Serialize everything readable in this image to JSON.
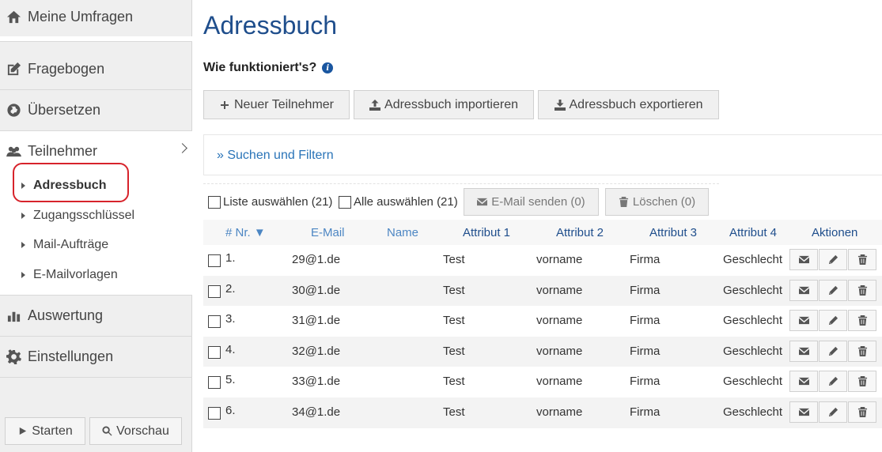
{
  "sidebar": {
    "my_surveys": "Meine Umfragen",
    "questionnaire": "Fragebogen",
    "translate": "Übersetzen",
    "participants": "Teilnehmer",
    "sub_items": [
      "Adressbuch",
      "Zugangsschlüssel",
      "Mail-Aufträge",
      "E-Mailvorlagen"
    ],
    "evaluation": "Auswertung",
    "settings": "Einstellungen",
    "start_button": "Starten",
    "preview_button": "Vorschau"
  },
  "main": {
    "title": "Adressbuch",
    "howto": "Wie funktioniert's?",
    "info_icon": "i",
    "buttons": {
      "new_participant": "Neuer Teilnehmer",
      "import": "Adressbuch importieren",
      "export": "Adressbuch exportieren"
    },
    "filter_link": "» Suchen und Filtern",
    "select_list": "Liste auswählen (21)",
    "select_all": "Alle auswählen (21)",
    "send_email": "E-Mail senden (0)",
    "delete": "Löschen (0)"
  },
  "table": {
    "headers": {
      "nr": "# Nr. ▼",
      "email": "E-Mail",
      "name": "Name",
      "attr1": "Attribut 1",
      "attr2": "Attribut 2",
      "attr3": "Attribut 3",
      "attr4": "Attribut 4",
      "actions": "Aktionen"
    },
    "rows": [
      {
        "nr": "1.",
        "email": "29@1.de",
        "name": "",
        "attr1": "Test",
        "attr2": "vorname",
        "attr3": "Firma",
        "attr4": "Geschlecht"
      },
      {
        "nr": "2.",
        "email": "30@1.de",
        "name": "",
        "attr1": "Test",
        "attr2": "vorname",
        "attr3": "Firma",
        "attr4": "Geschlecht"
      },
      {
        "nr": "3.",
        "email": "31@1.de",
        "name": "",
        "attr1": "Test",
        "attr2": "vorname",
        "attr3": "Firma",
        "attr4": "Geschlecht"
      },
      {
        "nr": "4.",
        "email": "32@1.de",
        "name": "",
        "attr1": "Test",
        "attr2": "vorname",
        "attr3": "Firma",
        "attr4": "Geschlecht"
      },
      {
        "nr": "5.",
        "email": "33@1.de",
        "name": "",
        "attr1": "Test",
        "attr2": "vorname",
        "attr3": "Firma",
        "attr4": "Geschlecht"
      },
      {
        "nr": "6.",
        "email": "34@1.de",
        "name": "",
        "attr1": "Test",
        "attr2": "vorname",
        "attr3": "Firma",
        "attr4": "Geschlecht"
      }
    ]
  },
  "colors": {
    "title_blue": "#1f4e8c",
    "link_blue": "#2a74b8",
    "highlight_red": "#d7232b"
  }
}
